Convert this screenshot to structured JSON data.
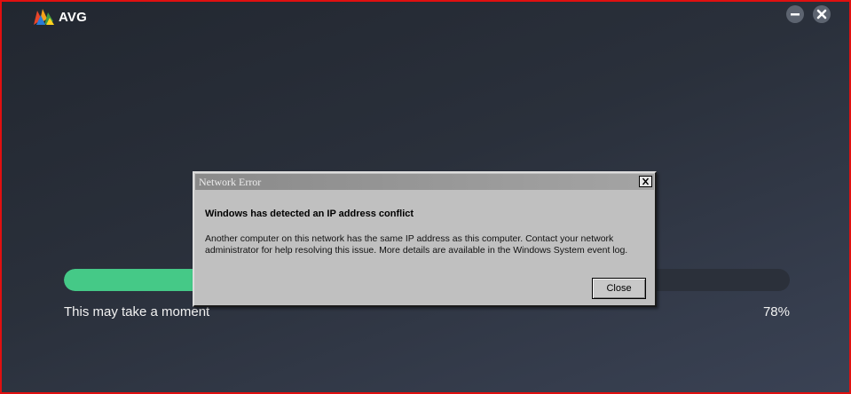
{
  "app": {
    "brand": "AVG",
    "minimize_icon": "minus-icon",
    "close_icon": "close-icon"
  },
  "progress": {
    "caption": "This may take a moment",
    "percent_label": "78%",
    "value": 0.78,
    "fill_color": "#45c987"
  },
  "dialog": {
    "title": "Network Error",
    "heading": "Windows has detected an IP address conflict",
    "message_line1": "Another computer on this network has the same IP address as this computer. Contact your network",
    "message_line2": "administrator for help resolving this issue. More details are available in the Windows System event log.",
    "close_label": "Close"
  },
  "colors": {
    "frame_border": "#e01010",
    "background": "#2a303b",
    "dialog_bg": "#c0c0c0"
  }
}
